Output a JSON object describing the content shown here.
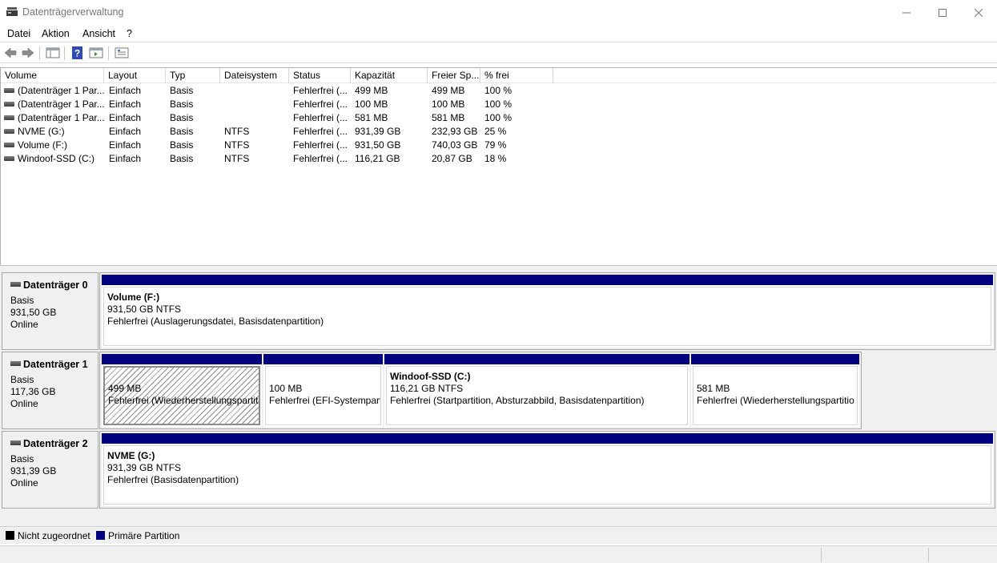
{
  "window": {
    "title": "Datenträgerverwaltung"
  },
  "menu": {
    "items": [
      "Datei",
      "Aktion",
      "Ansicht",
      "?"
    ]
  },
  "toolbar": {
    "icons": [
      "back-arrow-icon",
      "forward-arrow-icon",
      "console-tree-icon",
      "help-icon",
      "action-pane-icon",
      "properties-icon"
    ]
  },
  "list": {
    "headers": [
      "Volume",
      "Layout",
      "Typ",
      "Dateisystem",
      "Status",
      "Kapazität",
      "Freier Sp...",
      "% frei"
    ],
    "rows": [
      {
        "volume": "(Datenträger 1 Par...",
        "layout": "Einfach",
        "typ": "Basis",
        "fs": "",
        "status": "Fehlerfrei (...",
        "kap": "499 MB",
        "frei": "499 MB",
        "pct": "100 %"
      },
      {
        "volume": "(Datenträger 1 Par...",
        "layout": "Einfach",
        "typ": "Basis",
        "fs": "",
        "status": "Fehlerfrei (...",
        "kap": "100 MB",
        "frei": "100 MB",
        "pct": "100 %"
      },
      {
        "volume": "(Datenträger 1 Par...",
        "layout": "Einfach",
        "typ": "Basis",
        "fs": "",
        "status": "Fehlerfrei (...",
        "kap": "581 MB",
        "frei": "581 MB",
        "pct": "100 %"
      },
      {
        "volume": "NVME (G:)",
        "layout": "Einfach",
        "typ": "Basis",
        "fs": "NTFS",
        "status": "Fehlerfrei (...",
        "kap": "931,39 GB",
        "frei": "232,93 GB",
        "pct": "25 %"
      },
      {
        "volume": "Volume (F:)",
        "layout": "Einfach",
        "typ": "Basis",
        "fs": "NTFS",
        "status": "Fehlerfrei (...",
        "kap": "931,50 GB",
        "frei": "740,03 GB",
        "pct": "79 %"
      },
      {
        "volume": "Windoof-SSD (C:)",
        "layout": "Einfach",
        "typ": "Basis",
        "fs": "NTFS",
        "status": "Fehlerfrei (...",
        "kap": "116,21 GB",
        "frei": "20,87 GB",
        "pct": "18 %"
      }
    ]
  },
  "disks": [
    {
      "name": "Datenträger 0",
      "type": "Basis",
      "size": "931,50 GB",
      "state": "Online",
      "partitions": [
        {
          "title": "Volume  (F:)",
          "size": "931,50 GB NTFS",
          "status": "Fehlerfrei (Auslagerungsdatei, Basisdatenpartition)"
        }
      ]
    },
    {
      "name": "Datenträger 1",
      "type": "Basis",
      "size": "117,36 GB",
      "state": "Online",
      "partitions": [
        {
          "title": "",
          "size": "499 MB",
          "status": "Fehlerfrei (Wiederherstellungspartiti"
        },
        {
          "title": "",
          "size": "100 MB",
          "status": "Fehlerfrei (EFI-Systempart"
        },
        {
          "title": "Windoof-SSD  (C:)",
          "size": "116,21 GB NTFS",
          "status": "Fehlerfrei (Startpartition, Absturzabbild, Basisdatenpartition)"
        },
        {
          "title": "",
          "size": "581 MB",
          "status": "Fehlerfrei (Wiederherstellungspartitio"
        }
      ]
    },
    {
      "name": "Datenträger 2",
      "type": "Basis",
      "size": "931,39 GB",
      "state": "Online",
      "partitions": [
        {
          "title": "NVME  (G:)",
          "size": "931,39 GB NTFS",
          "status": "Fehlerfrei (Basisdatenpartition)"
        }
      ]
    }
  ],
  "legend": [
    {
      "label": "Nicht zugeordnet",
      "color": "#000000"
    },
    {
      "label": "Primäre Partition",
      "color": "#00007f"
    }
  ]
}
